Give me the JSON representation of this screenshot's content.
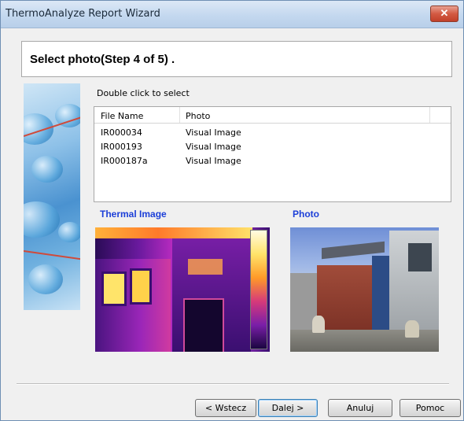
{
  "window": {
    "title": "ThermoAnalyze Report Wizard",
    "close_label": "✕"
  },
  "header": {
    "title": "Select photo(Step 4 of 5) ."
  },
  "list": {
    "hint": "Double click to select",
    "columns": [
      "File Name",
      "Photo"
    ],
    "rows": [
      {
        "file": "IR000034",
        "photo": "Visual Image"
      },
      {
        "file": "IR000193",
        "photo": "Visual Image"
      },
      {
        "file": "IR000187a",
        "photo": "Visual Image"
      }
    ]
  },
  "preview": {
    "thermal_label": "Thermal Image",
    "photo_label": "Photo"
  },
  "buttons": {
    "back": "< Wstecz",
    "next": "Dalej >",
    "cancel": "Anuluj",
    "help": "Pomoc"
  },
  "colors": {
    "label_blue": "#1c3fd8",
    "close_red": "#c1402a"
  }
}
